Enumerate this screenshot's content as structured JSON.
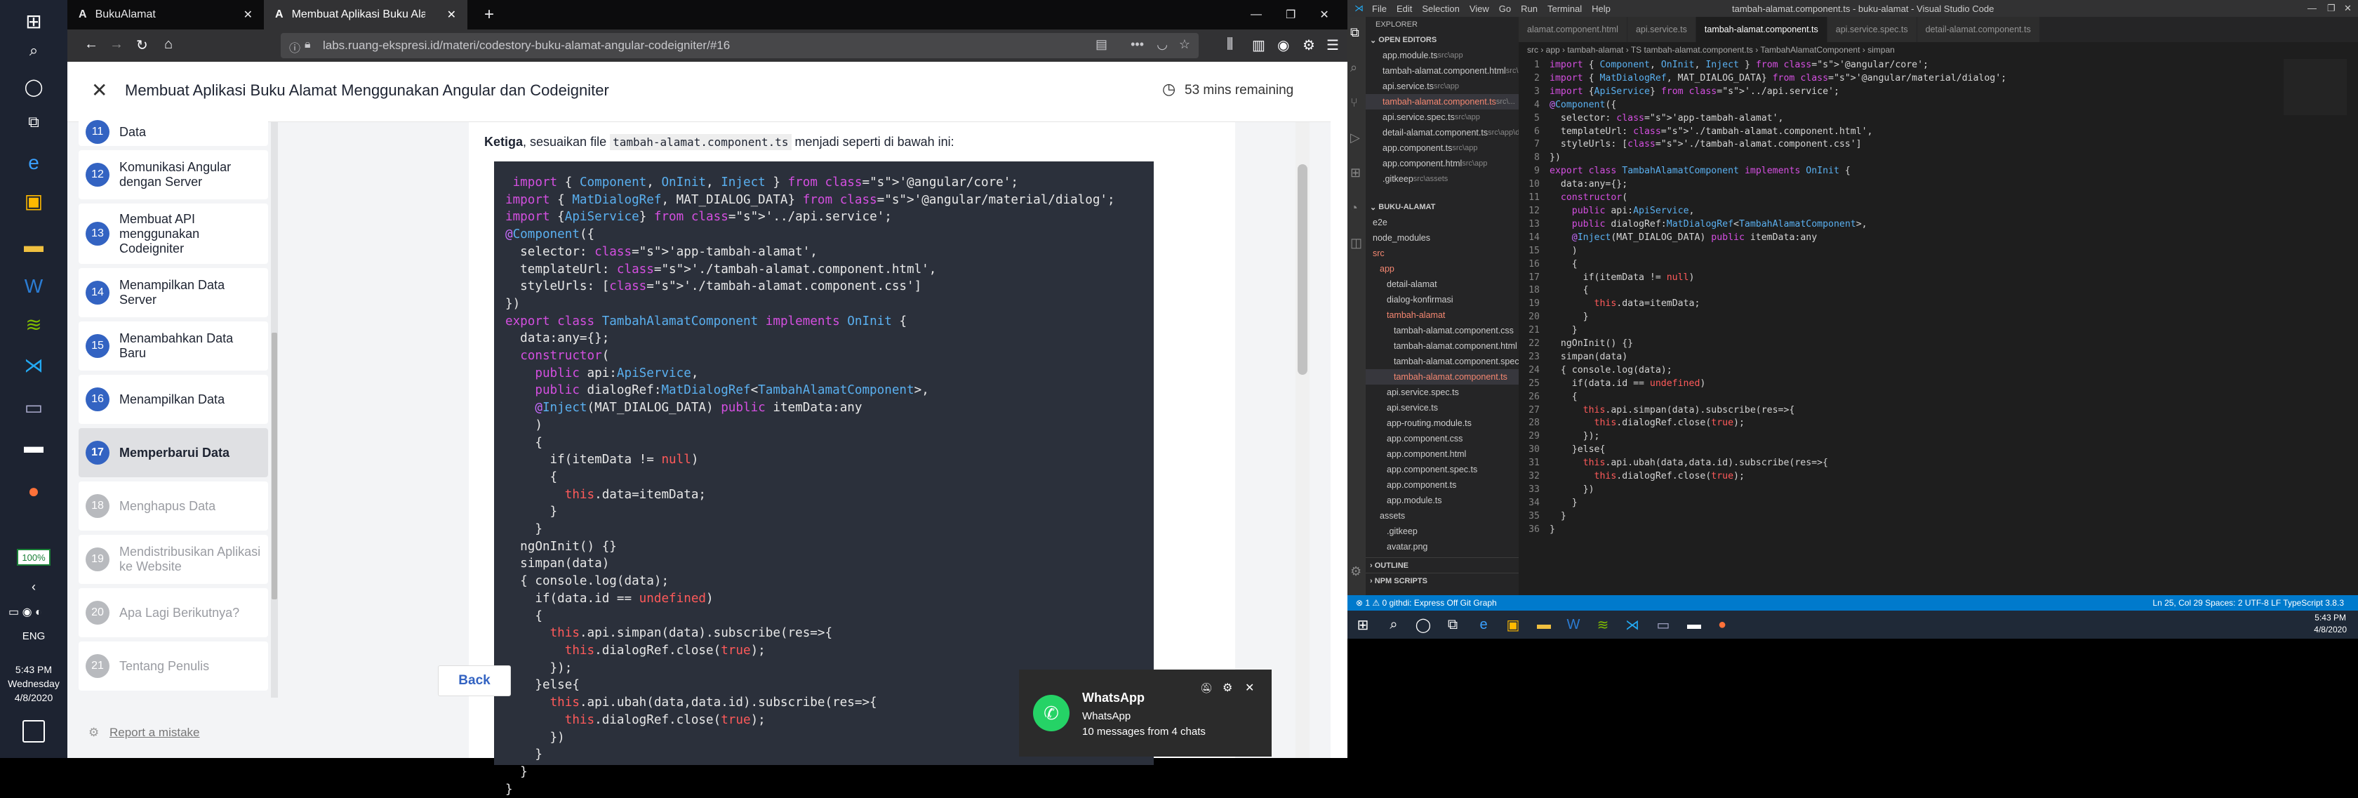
{
  "vtaskbar": {
    "zoom": "100%",
    "lang": "ENG",
    "time": "5:43 PM",
    "day": "Wednesday",
    "date": "4/8/2020"
  },
  "firefox": {
    "tabs": [
      {
        "label": "BukuAlamat"
      },
      {
        "label": "Membuat Aplikasi Buku Alamat Me"
      }
    ],
    "url": "labs.ruang-ekspresi.id/materi/codestory-buku-alamat-angular-codeigniter/#16"
  },
  "course": {
    "title": "Membuat Aplikasi Buku Alamat Menggunakan Angular dan Codeigniter",
    "timer": "53 mins remaining",
    "lessons": [
      {
        "num": "11",
        "label": "Data",
        "state": "done"
      },
      {
        "num": "12",
        "label": "Komunikasi Angular dengan Server",
        "state": "done"
      },
      {
        "num": "13",
        "label": "Membuat API menggunakan Codeigniter",
        "state": "done"
      },
      {
        "num": "14",
        "label": "Menampilkan Data Server",
        "state": "done"
      },
      {
        "num": "15",
        "label": "Menambahkan Data Baru",
        "state": "done"
      },
      {
        "num": "16",
        "label": "Menampilkan Data",
        "state": "done"
      },
      {
        "num": "17",
        "label": "Memperbarui Data",
        "state": "active"
      },
      {
        "num": "18",
        "label": "Menghapus Data",
        "state": "locked"
      },
      {
        "num": "19",
        "label": "Mendistribusikan Aplikasi ke Website",
        "state": "locked"
      },
      {
        "num": "20",
        "label": "Apa Lagi Berikutnya?",
        "state": "locked"
      },
      {
        "num": "21",
        "label": "Tentang Penulis",
        "state": "locked"
      }
    ],
    "report": "Report a mistake",
    "back_button": "Back",
    "intro_bold": "Ketiga",
    "intro_text1": ", sesuaikan file ",
    "intro_file": "tambah-alamat.component.ts",
    "intro_text2": " menjadi seperti di bawah ini:"
  },
  "notification": {
    "app": "WhatsApp",
    "line1": "WhatsApp",
    "line2": "10 messages from 4 chats"
  },
  "vscode": {
    "title": "tambah-alamat.component.ts - buku-alamat - Visual Studio Code",
    "menu": [
      "File",
      "Edit",
      "Selection",
      "View",
      "Go",
      "Run",
      "Terminal",
      "Help"
    ],
    "explorer_title": "EXPLORER",
    "open_editors_title": "OPEN EDITORS",
    "open_editors": [
      {
        "name": "app.module.ts",
        "path": "src\\app"
      },
      {
        "name": "tambah-alamat.component.html",
        "path": "src\\..."
      },
      {
        "name": "api.service.ts",
        "path": "src\\app"
      },
      {
        "name": "tambah-alamat.component.ts",
        "path": "src\\..."
      },
      {
        "name": "api.service.spec.ts",
        "path": "src\\app"
      },
      {
        "name": "detail-alamat.component.ts",
        "path": "src\\app\\d..."
      },
      {
        "name": "app.component.ts",
        "path": "src\\app"
      },
      {
        "name": "app.component.html",
        "path": "src\\app"
      },
      {
        "name": ".gitkeep",
        "path": "src\\assets"
      }
    ],
    "project_title": "BUKU-ALAMAT",
    "tree": [
      {
        "name": "e2e",
        "indent": 1
      },
      {
        "name": "node_modules",
        "indent": 1
      },
      {
        "name": "src",
        "indent": 1
      },
      {
        "name": "app",
        "indent": 2
      },
      {
        "name": "detail-alamat",
        "indent": 3
      },
      {
        "name": "dialog-konfirmasi",
        "indent": 3
      },
      {
        "name": "tambah-alamat",
        "indent": 3
      },
      {
        "name": "tambah-alamat.component.css",
        "indent": 4
      },
      {
        "name": "tambah-alamat.component.html",
        "indent": 4
      },
      {
        "name": "tambah-alamat.component.spec.ts",
        "indent": 4
      },
      {
        "name": "tambah-alamat.component.ts",
        "indent": 4
      },
      {
        "name": "api.service.spec.ts",
        "indent": 3
      },
      {
        "name": "api.service.ts",
        "indent": 3
      },
      {
        "name": "app-routing.module.ts",
        "indent": 3
      },
      {
        "name": "app.component.css",
        "indent": 3
      },
      {
        "name": "app.component.html",
        "indent": 3
      },
      {
        "name": "app.component.spec.ts",
        "indent": 3
      },
      {
        "name": "app.component.ts",
        "indent": 3
      },
      {
        "name": "app.module.ts",
        "indent": 3
      },
      {
        "name": "assets",
        "indent": 2
      },
      {
        "name": ".gitkeep",
        "indent": 3
      },
      {
        "name": "avatar.png",
        "indent": 3
      }
    ],
    "outline": "OUTLINE",
    "npm": "NPM SCRIPTS",
    "tabs": [
      "alamat.component.html",
      "api.service.ts",
      "tambah-alamat.component.ts",
      "api.service.spec.ts",
      "detail-alamat.component.ts"
    ],
    "breadcrumb": "src › app › tambah-alamat › TS tambah-alamat.component.ts › TambahAlamatComponent › simpan",
    "status_left": "⊗ 1 ⚠ 0    githdi: Express Off    Git Graph",
    "status_right": "Ln 25, Col 29   Spaces: 2   UTF-8   LF   TypeScript   3.8.3",
    "taskbar_time": "5:43 PM",
    "taskbar_date": "4/8/2020"
  },
  "code_lines": [
    "import { Component, OnInit, Inject } from '@angular/core';",
    "import { MatDialogRef, MAT_DIALOG_DATA} from '@angular/material/dialog';",
    "import {ApiService} from '../api.service';",
    "@Component({",
    "  selector: 'app-tambah-alamat',",
    "  templateUrl: './tambah-alamat.component.html',",
    "  styleUrls: ['./tambah-alamat.component.css']",
    "})",
    "export class TambahAlamatComponent implements OnInit {",
    "  data:any={};",
    "  constructor(",
    "    public api:ApiService,",
    "    public dialogRef:MatDialogRef<TambahAlamatComponent>,",
    "    @Inject(MAT_DIALOG_DATA) public itemData:any",
    "    )",
    "    {",
    "      if(itemData != null)",
    "      {",
    "        this.data=itemData;",
    "      }",
    "    }",
    "  ngOnInit() {}",
    "  simpan(data)",
    "  { console.log(data);",
    "    if(data.id == undefined)",
    "    {",
    "      this.api.simpan(data).subscribe(res=>{",
    "        this.dialogRef.close(true);",
    "      });",
    "    }else{",
    "      this.api.ubah(data,data.id).subscribe(res=>{",
    "        this.dialogRef.close(true);",
    "      })",
    "    }",
    "  }",
    "}"
  ]
}
